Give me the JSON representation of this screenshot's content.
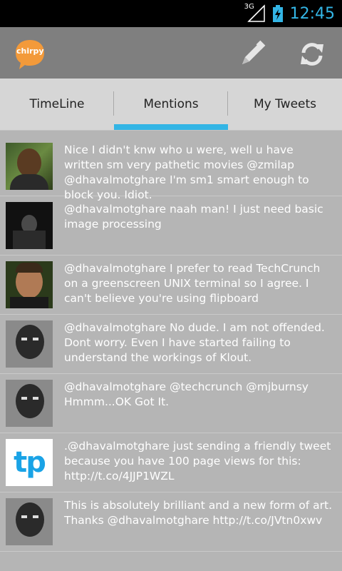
{
  "status": {
    "network": "3G",
    "time": "12:45"
  },
  "app": {
    "logo_text": "chirpy"
  },
  "tabs": [
    {
      "label": "TimeLine"
    },
    {
      "label": "Mentions"
    },
    {
      "label": "My Tweets"
    }
  ],
  "active_tab": "Mentions",
  "tweets": [
    {
      "text": "Nice I didn't knw who u were, well u have written sm very pathetic movies @zmilap @dhavalmotghare I'm sm1 smart enough to block you. Idiot."
    },
    {
      "text": "@dhavalmotghare naah man! I just need basic image processing"
    },
    {
      "text": "@dhavalmotghare I prefer to read TechCrunch on a greenscreen UNIX terminal so I agree. I can't believe you're using flipboard"
    },
    {
      "text": "@dhavalmotghare No dude. I am not offended. Dont worry. Even I have started failing to understand the workings of Klout."
    },
    {
      "text": "@dhavalmotghare @techcrunch @mjburnsy Hmmm...OK Got It."
    },
    {
      "text": ".@dhavalmotghare just sending a friendly tweet because you have 100 page views for this: http://t.co/4JJP1WZL",
      "avatar_text": "tp"
    },
    {
      "text": "This is absolutely brilliant and a new form of art. Thanks @dhavalmotghare http://t.co/JVtn0xwv"
    }
  ],
  "icons": {
    "logo": "chirpy-logo-icon",
    "compose": "pencil-icon",
    "refresh": "refresh-icon"
  },
  "colors": {
    "accent": "#33b5e5",
    "actionbar": "#7f7f7f",
    "tabs_bg": "#d6d6d6",
    "list_bg": "#b5b5b5",
    "logo": "#f39a3a"
  }
}
